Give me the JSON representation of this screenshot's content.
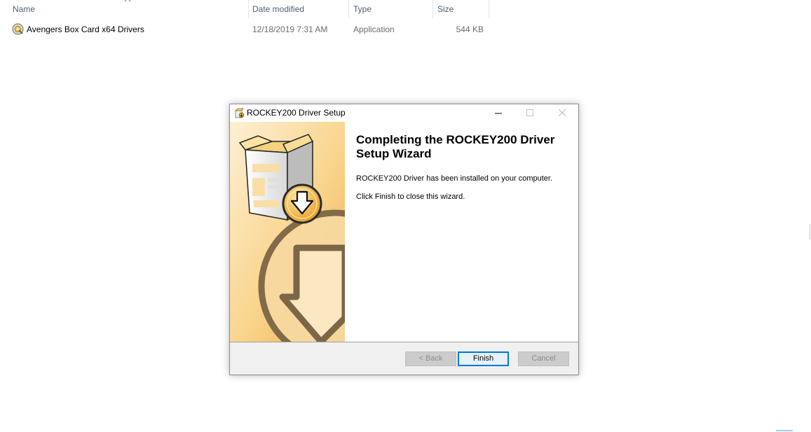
{
  "explorer": {
    "columns": {
      "name": "Name",
      "date_modified": "Date modified",
      "type": "Type",
      "size": "Size"
    },
    "files": [
      {
        "name": "Avengers Box Card x64 Drivers",
        "date_modified": "12/18/2019 7:31 AM",
        "type": "Application",
        "size": "544 KB",
        "icon": "installer-disc-icon"
      }
    ]
  },
  "dialog": {
    "title": "ROCKEY200 Driver Setup",
    "heading": "Completing the ROCKEY200 Driver Setup Wizard",
    "message_installed": "ROCKEY200 Driver has been installed on your computer.",
    "message_finish": "Click Finish to close this wizard.",
    "buttons": {
      "back": "< Back",
      "finish": "Finish",
      "cancel": "Cancel"
    },
    "colors": {
      "focus": "#0078d7",
      "panel_light": "#fbe3b4",
      "panel_dark": "#f2b34c"
    }
  }
}
